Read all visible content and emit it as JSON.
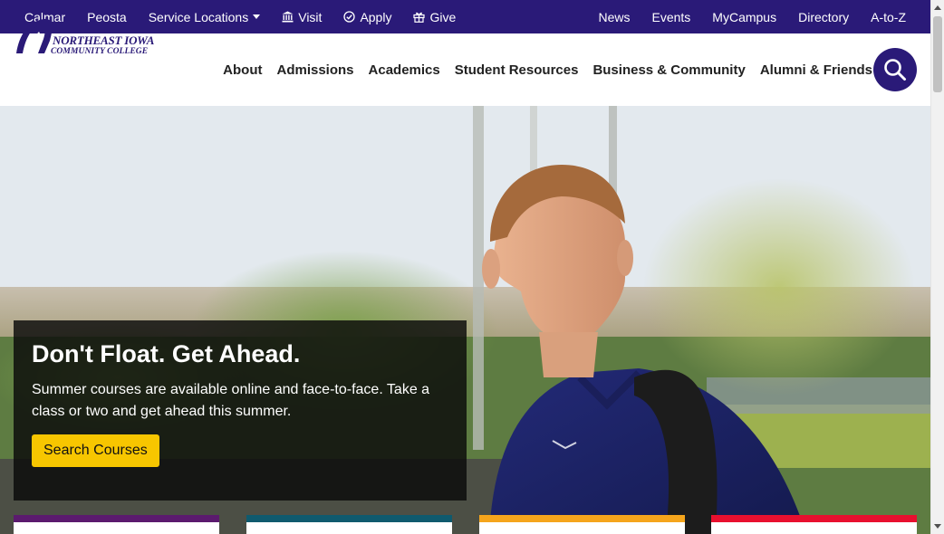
{
  "utility": {
    "left": [
      {
        "label": "Calmar"
      },
      {
        "label": "Peosta"
      },
      {
        "label": "Service Locations"
      },
      {
        "label": "Visit",
        "icon": "institution-icon"
      },
      {
        "label": "Apply",
        "icon": "check-circle-icon"
      },
      {
        "label": "Give",
        "icon": "gift-icon"
      }
    ],
    "right": [
      {
        "label": "News"
      },
      {
        "label": "Events"
      },
      {
        "label": "MyCampus"
      },
      {
        "label": "Directory"
      },
      {
        "label": "A-to-Z"
      }
    ]
  },
  "logo": {
    "line1": "NORTHEAST IOWA",
    "line2": "COMMUNITY COLLEGE"
  },
  "nav": [
    {
      "label": "About"
    },
    {
      "label": "Admissions"
    },
    {
      "label": "Academics"
    },
    {
      "label": "Student Resources"
    },
    {
      "label": "Business & Community"
    },
    {
      "label": "Alumni & Friends"
    }
  ],
  "search": {
    "icon": "search-icon"
  },
  "hero": {
    "title": "Don't Float. Get Ahead.",
    "text": "Summer courses are available online and face-to-face. Take a class or two and get ahead this summer.",
    "button": "Search Courses"
  },
  "colors": {
    "brand": "#2a1a78",
    "button": "#f7c600",
    "accent_bars": [
      "#5b1a6e",
      "#0f5a6e",
      "#f5a51c",
      "#e8102f"
    ]
  }
}
